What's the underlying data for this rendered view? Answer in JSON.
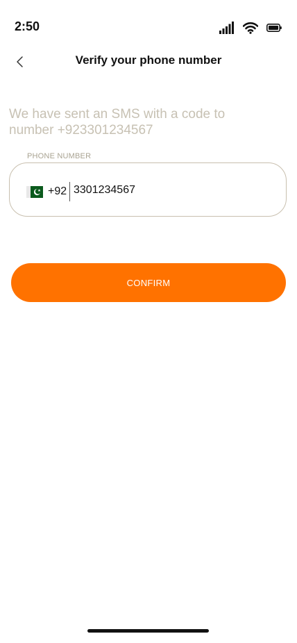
{
  "status_bar": {
    "time": "2:50",
    "icons": [
      "signal-icon",
      "wifi-icon",
      "battery-icon"
    ]
  },
  "header": {
    "back_icon": "chevron-left-icon",
    "title": "Verify your phone number"
  },
  "message": {
    "text": "We have sent an SMS with a code to number +923301234567"
  },
  "phone_field": {
    "label": "PHONE NUMBER",
    "flag": "pakistan-flag-icon",
    "country_code": "+92",
    "value": "3301234567"
  },
  "confirm": {
    "label": "CONFIRM"
  },
  "colors": {
    "accent": "#ff7200",
    "message_text": "#c7c1b3",
    "field_border": "#c8bfae"
  }
}
